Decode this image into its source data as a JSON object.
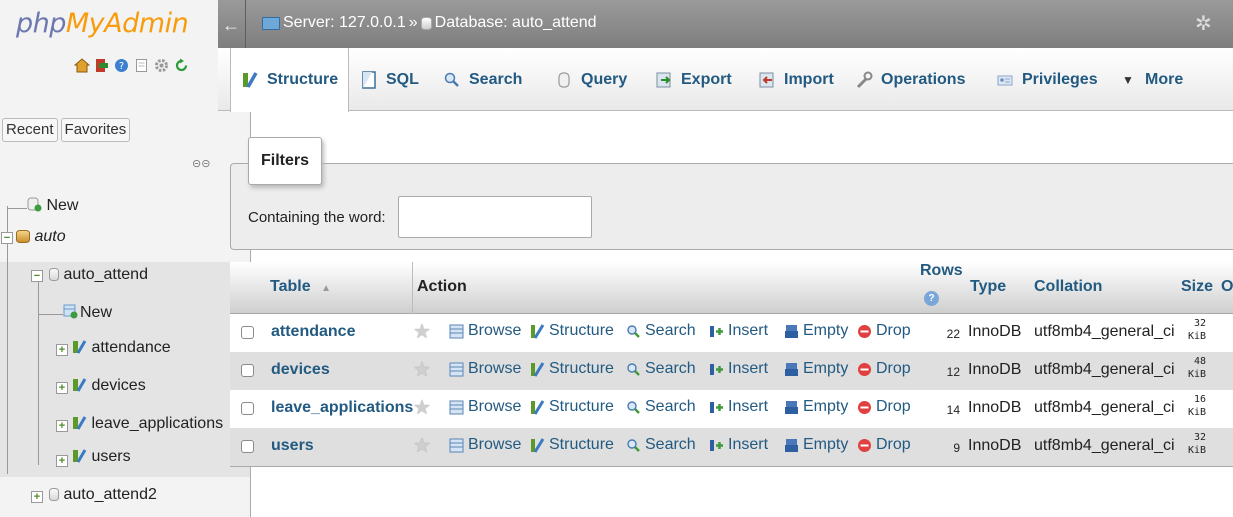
{
  "nav": {
    "logo_php": "php",
    "logo_myadmin": "MyAdmin",
    "icons": [
      "home-icon",
      "exit-icon",
      "help-icon",
      "docs-icon",
      "settings-icon",
      "reload-icon"
    ],
    "recent_label": "Recent",
    "favorites_label": "Favorites",
    "tree": {
      "new_label": "New",
      "server_db": "auto",
      "database": "auto_attend",
      "db_new_label": "New",
      "tables": [
        "attendance",
        "devices",
        "leave_applications",
        "users"
      ],
      "other_database": "auto_attend2"
    }
  },
  "topbar": {
    "server_label": "Server: 127.0.0.1",
    "separator": "»",
    "database_label": "Database: auto_attend"
  },
  "tabs": [
    {
      "label": "Structure",
      "icon": "structure-icon"
    },
    {
      "label": "SQL",
      "icon": "sql-icon"
    },
    {
      "label": "Search",
      "icon": "search-icon"
    },
    {
      "label": "Query",
      "icon": "query-icon"
    },
    {
      "label": "Export",
      "icon": "export-icon"
    },
    {
      "label": "Import",
      "icon": "import-icon"
    },
    {
      "label": "Operations",
      "icon": "operations-icon"
    },
    {
      "label": "Privileges",
      "icon": "privileges-icon"
    },
    {
      "label": "More",
      "icon": "triangle-down-icon"
    }
  ],
  "filters": {
    "legend": "Filters",
    "label": "Containing the word:",
    "value": ""
  },
  "table": {
    "headers": {
      "table": "Table",
      "sort_indicator": "▲",
      "action": "Action",
      "rows": "Rows",
      "type": "Type",
      "collation": "Collation",
      "size": "Size",
      "overhead": "O"
    },
    "actions": [
      "Browse",
      "Structure",
      "Search",
      "Insert",
      "Empty",
      "Drop"
    ],
    "rows": [
      {
        "name": "attendance",
        "rows": "22",
        "type": "InnoDB",
        "collation": "utf8mb4_general_ci",
        "size_value": "32",
        "size_unit": "KiB"
      },
      {
        "name": "devices",
        "rows": "12",
        "type": "InnoDB",
        "collation": "utf8mb4_general_ci",
        "size_value": "48",
        "size_unit": "KiB"
      },
      {
        "name": "leave_applications",
        "rows": "14",
        "type": "InnoDB",
        "collation": "utf8mb4_general_ci",
        "size_value": "16",
        "size_unit": "KiB"
      },
      {
        "name": "users",
        "rows": "9",
        "type": "InnoDB",
        "collation": "utf8mb4_general_ci",
        "size_value": "32",
        "size_unit": "KiB"
      }
    ]
  }
}
